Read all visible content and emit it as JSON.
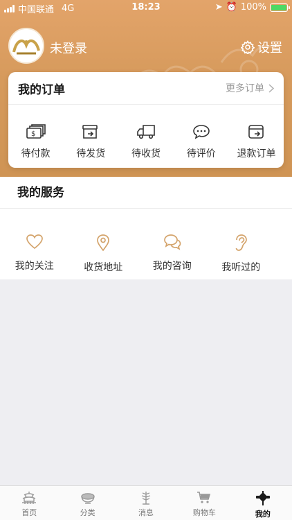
{
  "status_bar": {
    "carrier": "中国联通",
    "network": "4G",
    "time": "18:23",
    "battery": "100%"
  },
  "header": {
    "login_status": "未登录",
    "settings_label": "设置",
    "background_color": "#d99c5e"
  },
  "orders": {
    "title": "我的订单",
    "more_label": "更多订单",
    "items": [
      {
        "label": "待付款",
        "icon": "payment-pending-icon"
      },
      {
        "label": "待发货",
        "icon": "shipment-pending-icon"
      },
      {
        "label": "待收货",
        "icon": "delivery-truck-icon"
      },
      {
        "label": "待评价",
        "icon": "review-chat-icon"
      },
      {
        "label": "退款订单",
        "icon": "refund-icon"
      }
    ]
  },
  "services": {
    "title": "我的服务",
    "accent_color": "#d4a46c",
    "items": [
      {
        "label": "我的关注",
        "icon": "heart-icon"
      },
      {
        "label": "收货地址",
        "icon": "location-pin-icon"
      },
      {
        "label": "我的咨询",
        "icon": "consult-chat-icon"
      },
      {
        "label": "我听过的",
        "icon": "ear-icon"
      }
    ]
  },
  "tabbar": {
    "items": [
      {
        "label": "首页",
        "icon": "pagoda-icon"
      },
      {
        "label": "分类",
        "icon": "bowl-icon"
      },
      {
        "label": "消息",
        "icon": "bamboo-icon"
      },
      {
        "label": "购物车",
        "icon": "cart-icon"
      },
      {
        "label": "我的",
        "icon": "chinese-knot-icon",
        "active": true
      }
    ]
  }
}
